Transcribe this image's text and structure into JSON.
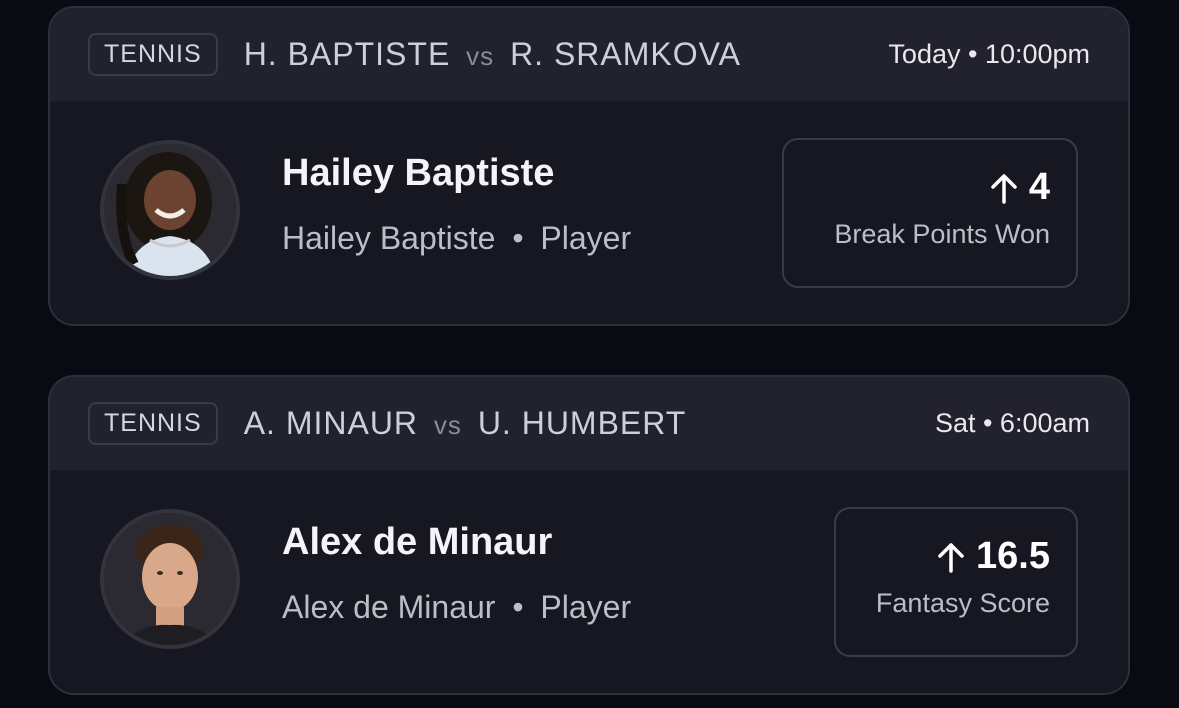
{
  "cards": [
    {
      "sport": "TENNIS",
      "player1": "H. BAPTISTE",
      "vs": "vs",
      "player2": "R. SRAMKOVA",
      "time": "Today • 10:00pm",
      "player_name": "Hailey Baptiste",
      "player_sub_name": "Hailey Baptiste",
      "player_sub_dot": "•",
      "player_role": "Player",
      "stat_value": "4",
      "stat_label": "Break Points Won",
      "direction_icon": "arrow-up-icon"
    },
    {
      "sport": "TENNIS",
      "player1": "A. MINAUR",
      "vs": "vs",
      "player2": "U. HUMBERT",
      "time": "Sat • 6:00am",
      "player_name": "Alex de Minaur",
      "player_sub_name": "Alex de Minaur",
      "player_sub_dot": "•",
      "player_role": "Player",
      "stat_value": "16.5",
      "stat_label": "Fantasy Score",
      "direction_icon": "arrow-up-icon"
    }
  ],
  "colors": {
    "background": "#0a0b12",
    "card": "#1a1a26",
    "header": "#22222e",
    "border": "#2e2e3c"
  }
}
